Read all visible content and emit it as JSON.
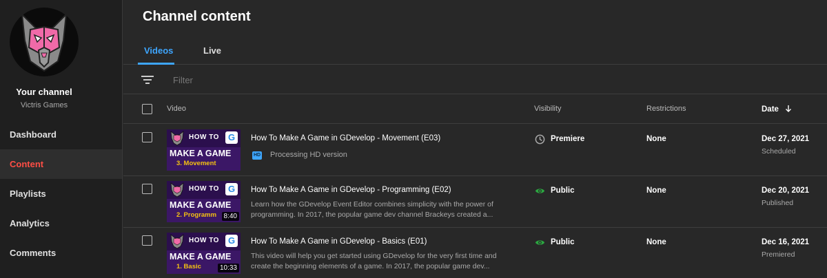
{
  "sidebar": {
    "channel_title": "Your channel",
    "channel_name": "Victris Games",
    "items": [
      {
        "label": "Dashboard"
      },
      {
        "label": "Content"
      },
      {
        "label": "Playlists"
      },
      {
        "label": "Analytics"
      },
      {
        "label": "Comments"
      }
    ],
    "active_item": "Content"
  },
  "main": {
    "title": "Channel content",
    "tabs": [
      {
        "label": "Videos"
      },
      {
        "label": "Live"
      }
    ],
    "active_tab": "Videos",
    "filter": {
      "placeholder": "Filter"
    },
    "columns": {
      "video": "Video",
      "visibility": "Visibility",
      "restrictions": "Restrictions",
      "date": "Date"
    },
    "rows": [
      {
        "thumb_line1": "HOW TO",
        "thumb_line2": "MAKE A GAME",
        "thumb_episode": "3. Movement",
        "duration": "",
        "title": "How To Make A Game in GDevelop - Movement (E03)",
        "status_badge": "HD",
        "status_text": "Processing HD version",
        "description": "",
        "visibility": "Premiere",
        "visibility_icon": "clock-icon",
        "restrictions": "None",
        "date": "Dec 27, 2021",
        "date_status": "Scheduled"
      },
      {
        "thumb_line1": "HOW TO",
        "thumb_line2": "MAKE A GAME",
        "thumb_episode": "2. Programm",
        "duration": "8:40",
        "title": "How To Make A Game in GDevelop - Programming (E02)",
        "status_badge": "",
        "status_text": "",
        "description": "Learn how the GDevelop Event Editor combines simplicity with the power of programming. In 2017, the popular game dev channel Brackeys created a...",
        "visibility": "Public",
        "visibility_icon": "eye-icon",
        "restrictions": "None",
        "date": "Dec 20, 2021",
        "date_status": "Published"
      },
      {
        "thumb_line1": "HOW TO",
        "thumb_line2": "MAKE A GAME",
        "thumb_episode": "1. Basic",
        "duration": "10:33",
        "title": "How To Make A Game in GDevelop - Basics (E01)",
        "status_badge": "",
        "status_text": "",
        "description": "This video will help you get started using GDevelop for the very first time and create the beginning elements of a game. In 2017, the popular game dev...",
        "visibility": "Public",
        "visibility_icon": "eye-icon",
        "restrictions": "None",
        "date": "Dec 16, 2021",
        "date_status": "Premiered"
      }
    ]
  },
  "colors": {
    "accent_blue": "#3ea6ff",
    "active_red": "#ff4e45",
    "public_green": "#2ba640",
    "thumb_purple": "#3b1766",
    "thumb_yellow": "#f5c211"
  }
}
